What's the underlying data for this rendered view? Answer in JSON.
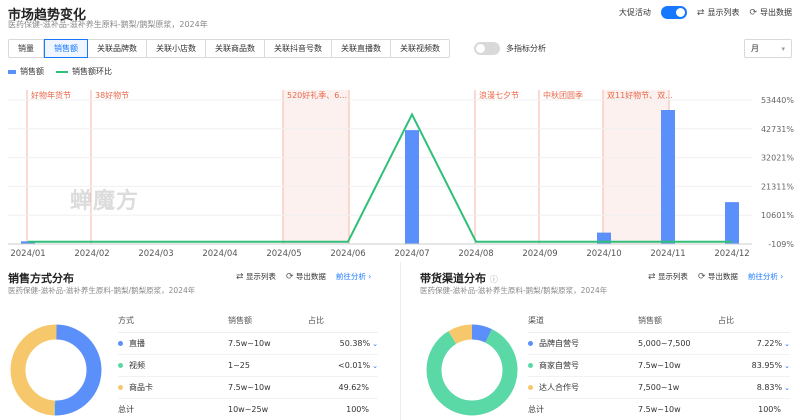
{
  "header": {
    "title": "市场趋势变化",
    "subtitle": "医药保健-滋补品-滋补养生原料-鹅梨/鹅梨原浆，2024年",
    "promo_label": "大促活动",
    "show_list": "显示列表",
    "export": "导出数据"
  },
  "tabs": [
    {
      "label": "销量"
    },
    {
      "label": "销售额"
    },
    {
      "label": "关联品牌数"
    },
    {
      "label": "关联小店数"
    },
    {
      "label": "关联商品数"
    },
    {
      "label": "关联抖音号数"
    },
    {
      "label": "关联直播数"
    },
    {
      "label": "关联视频数"
    }
  ],
  "active_tab": "销售额",
  "multi_metric": "多指标分析",
  "period_select": "月",
  "watermark": "蝉魔方",
  "chart_data": {
    "type": "bar",
    "categories": [
      "2024/01",
      "2024/02",
      "2024/03",
      "2024/04",
      "2024/05",
      "2024/06",
      "2024/07",
      "2024/08",
      "2024/09",
      "2024/10",
      "2024/11",
      "2024/12"
    ],
    "series": [
      {
        "name": "销售额",
        "kind": "bar",
        "color": "#5b8ff9",
        "values": [
          1.6,
          0,
          0,
          0,
          0,
          0,
          68,
          0.3,
          0,
          6.8,
          80,
          25
        ]
      },
      {
        "name": "销售额环比",
        "kind": "line",
        "color": "#30bf78",
        "values": [
          0,
          0,
          0,
          0,
          0,
          0,
          48000,
          0,
          0,
          0,
          0,
          0
        ]
      }
    ],
    "ylim_right": [
      -109,
      53440
    ],
    "right_ticks": [
      "53440%",
      "42731%",
      "32021%",
      "21311%",
      "10601%",
      "-109%"
    ],
    "legend_position": "top-left",
    "events": [
      {
        "label": "好物年货节",
        "from": 0,
        "to": 0
      },
      {
        "label": "38好物节",
        "from": 1,
        "to": 1
      },
      {
        "label": "520好礼季、6...",
        "from": 4,
        "to": 5
      },
      {
        "label": "浪漫七夕节",
        "from": 7,
        "to": 7
      },
      {
        "label": "中秋团圆季",
        "from": 8,
        "to": 8
      },
      {
        "label": "双11好物节、双...",
        "from": 9,
        "to": 10
      }
    ]
  },
  "sales_method": {
    "title": "销售方式分布",
    "subtitle": "医药保健-滋补品-滋补养生原料-鹅梨/鹅梨原浆，2024年",
    "show_list": "显示列表",
    "export": "导出数据",
    "goto": "前往分析",
    "columns": [
      "方式",
      "销售额",
      "占比"
    ],
    "rows": [
      {
        "name": "直播",
        "sales": "7.5w~10w",
        "pct": "50.38%",
        "color": "#5b8ff9",
        "share": 50.38
      },
      {
        "name": "视频",
        "sales": "1~25",
        "pct": "<0.01%",
        "color": "#5ad8a6",
        "share": 0.01
      },
      {
        "name": "商品卡",
        "sales": "7.5w~10w",
        "pct": "49.62%",
        "color": "#f6c86b",
        "share": 49.62
      }
    ],
    "total": {
      "name": "总计",
      "sales": "10w~25w",
      "pct": "100%"
    }
  },
  "channel": {
    "title": "带货渠道分布",
    "subtitle": "医药保健-滋补品-滋补养生原料-鹅梨/鹅梨原浆，2024年",
    "show_list": "显示列表",
    "export": "导出数据",
    "goto": "前往分析",
    "columns": [
      "渠道",
      "销售额",
      "占比"
    ],
    "rows": [
      {
        "name": "品牌自营号",
        "sales": "5,000~7,500",
        "pct": "7.22%",
        "color": "#5b8ff9",
        "share": 7.22
      },
      {
        "name": "商家自营号",
        "sales": "7.5w~10w",
        "pct": "83.95%",
        "color": "#5ad8a6",
        "share": 83.95
      },
      {
        "name": "达人合作号",
        "sales": "7,500~1w",
        "pct": "8.83%",
        "color": "#f6c86b",
        "share": 8.83
      }
    ],
    "total": {
      "name": "总计",
      "sales": "7.5w~10w",
      "pct": "100%"
    }
  }
}
